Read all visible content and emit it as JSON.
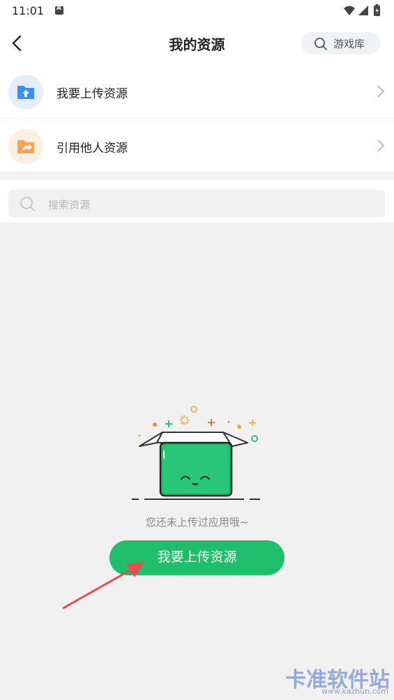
{
  "status_bar": {
    "time": "11:01"
  },
  "header": {
    "title": "我的资源",
    "game_library_label": "游戏库"
  },
  "menu": {
    "items": [
      {
        "label": "我要上传资源",
        "icon": "upload-folder-icon",
        "color": "#3d8ff5"
      },
      {
        "label": "引用他人资源",
        "icon": "share-folder-icon",
        "color": "#f5a25a"
      }
    ]
  },
  "search": {
    "placeholder": "搜索资源"
  },
  "empty_state": {
    "message": "您还未上传过应用哦~",
    "button_label": "我要上传资源"
  },
  "watermark": {
    "text": "卡准软件站",
    "url": "www.kazhun.com"
  },
  "colors": {
    "accent_green": "#1fbe6b",
    "annotation_red": "#e84c4c"
  }
}
